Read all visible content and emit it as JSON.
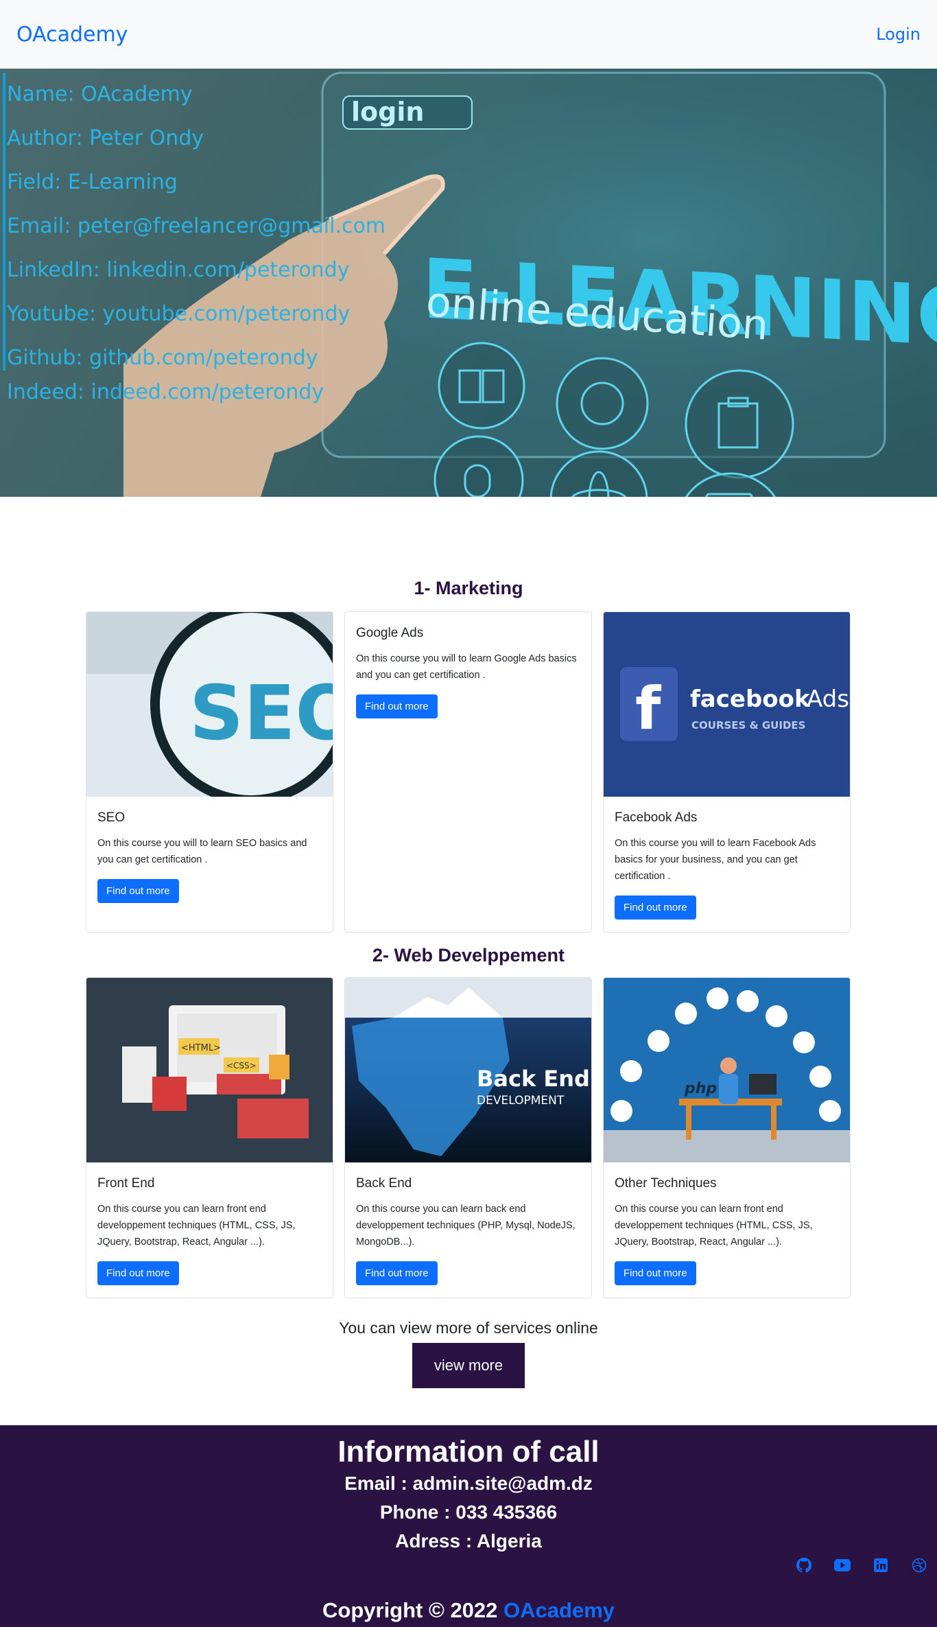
{
  "nav": {
    "brand": "OAcademy",
    "login": "Login"
  },
  "hero": {
    "info": [
      "Name: OAcademy",
      "Author: Peter Ondy",
      "Field: E-Learning",
      "Email: peter@freelancer@gmail.com",
      "LinkedIn: linkedin.com/peterondy",
      "Youtube: youtube.com/peterondy",
      "Github: github.com/peterondy",
      "Indeed: indeed.com/peterondy"
    ],
    "image_text": {
      "login": "login",
      "headline": "E-LEARNING",
      "sub": "online education"
    }
  },
  "marketing": {
    "title": "1- Marketing",
    "cards": [
      {
        "title": "SEO",
        "text": "On this course you will to learn SEO basics and you can get certification .",
        "button": "Find out more",
        "image_text": "SEO"
      },
      {
        "title": "Google Ads",
        "text": "On this course you will to learn Google Ads basics and you can get certification .",
        "button": "Find out more"
      },
      {
        "title": "Facebook Ads",
        "text": "On this course you will to learn Facebook Ads basics for your business, and you can get certification .",
        "button": "Find out more",
        "image_text": "facebook",
        "image_text2": "Ads",
        "image_sub": "COURSES & GUIDES"
      }
    ]
  },
  "web": {
    "title": "2- Web Develppement",
    "cards": [
      {
        "title": "Front End",
        "text": "On this course you can learn front end developpement techniques (HTML, CSS, JS, JQuery, Bootstrap, React, Angular ...).",
        "button": "Find out more",
        "image_text": "<HTML>",
        "image_text2": "<CSS>"
      },
      {
        "title": "Back End",
        "text": "On this course you can learn back end developpement techniques (PHP, Mysql, NodeJS, MongoDB...).",
        "button": "Find out more",
        "image_text": "Back End",
        "image_sub": "DEVELOPMENT"
      },
      {
        "title": "Other Techniques",
        "text": "On this course you can learn front end developpement techniques (HTML, CSS, JS, JQuery, Bootstrap, React, Angular ...).",
        "button": "Find out more",
        "image_text": "php"
      }
    ]
  },
  "more": {
    "text": "You can view more of services online",
    "button": "view more"
  },
  "footer": {
    "title": "Information of call",
    "email": "Email : admin.site@adm.dz",
    "phone": "Phone : 033 435366",
    "address": "Adress : Algeria",
    "copyright": "Copyright © 2022",
    "brand": "OAcademy",
    "socials": [
      "github-icon",
      "youtube-icon",
      "linkedin-icon",
      "dribbble-icon"
    ]
  },
  "colors": {
    "primary": "#0d6efd",
    "purple": "#2a1242",
    "hero_text": "#27b3e6"
  }
}
